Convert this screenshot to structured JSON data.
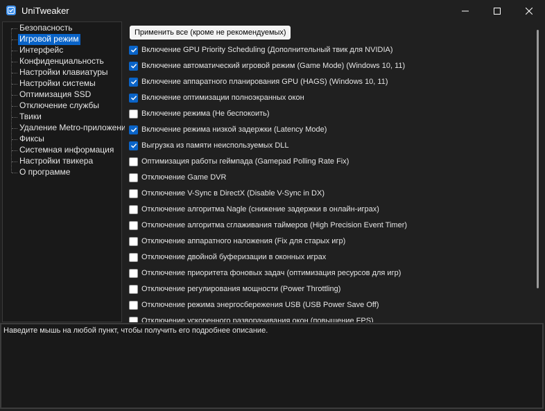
{
  "window": {
    "title": "UniTweaker",
    "accent": "#0a64c8"
  },
  "sidebar": {
    "items": [
      {
        "label": "Безопасность",
        "selected": false
      },
      {
        "label": "Игровой режим",
        "selected": true
      },
      {
        "label": "Интерфейс",
        "selected": false
      },
      {
        "label": "Конфиденциальность",
        "selected": false
      },
      {
        "label": "Настройки клавиатуры",
        "selected": false
      },
      {
        "label": "Настройки системы",
        "selected": false
      },
      {
        "label": "Оптимизация SSD",
        "selected": false
      },
      {
        "label": "Отключение службы",
        "selected": false
      },
      {
        "label": "Твики",
        "selected": false
      },
      {
        "label": "Удаление Metro-приложений",
        "selected": false
      },
      {
        "label": "Фиксы",
        "selected": false
      },
      {
        "label": "Системная информация",
        "selected": false
      },
      {
        "label": "Настройки твикера",
        "selected": false
      },
      {
        "label": "О программе",
        "selected": false
      }
    ]
  },
  "main": {
    "apply_label": "Применить все (кроме не рекомендуемых)",
    "options": [
      {
        "label": "Включение GPU Priority Scheduling (Дополнительный твик для NVIDIA)",
        "checked": true
      },
      {
        "label": "Включение автоматический игровой режим (Game Mode) (Windows 10, 11)",
        "checked": true
      },
      {
        "label": "Включение аппаратного планирования GPU (HAGS) (Windows 10, 11)",
        "checked": true
      },
      {
        "label": "Включение оптимизации полноэкранных окон",
        "checked": true
      },
      {
        "label": "Включение режима (Не беспокоить)",
        "checked": false
      },
      {
        "label": "Включение режима низкой задержки (Latency Mode)",
        "checked": true
      },
      {
        "label": "Выгрузка из памяти неиспользуемых DLL",
        "checked": true
      },
      {
        "label": "Оптимизация работы геймпада (Gamepad Polling Rate Fix)",
        "checked": false
      },
      {
        "label": "Отключение Game DVR",
        "checked": false
      },
      {
        "label": "Отключение V-Sync в DirectX (Disable V-Sync in DX)",
        "checked": false
      },
      {
        "label": "Отключение алгоритма Nagle (снижение задержки в онлайн-играх)",
        "checked": false
      },
      {
        "label": "Отключение алгоритма сглаживания таймеров (High Precision Event Timer)",
        "checked": false
      },
      {
        "label": "Отключение аппаратного наложения (Fix для старых игр)",
        "checked": false
      },
      {
        "label": "Отключение двойной буферизации в оконных играх",
        "checked": false
      },
      {
        "label": "Отключение приоритета фоновых задач (оптимизация ресурсов для игр)",
        "checked": false
      },
      {
        "label": "Отключение регулирования мощности (Power Throttling)",
        "checked": false
      },
      {
        "label": "Отключение режима энергосбережения USB (USB Power Save Off)",
        "checked": false
      },
      {
        "label": "Отключение ускоренного разворачивания окон (повышение FPS)",
        "checked": false
      }
    ]
  },
  "description": {
    "text": "Наведите мышь на любой пункт, чтобы получить его подробнее описание."
  }
}
